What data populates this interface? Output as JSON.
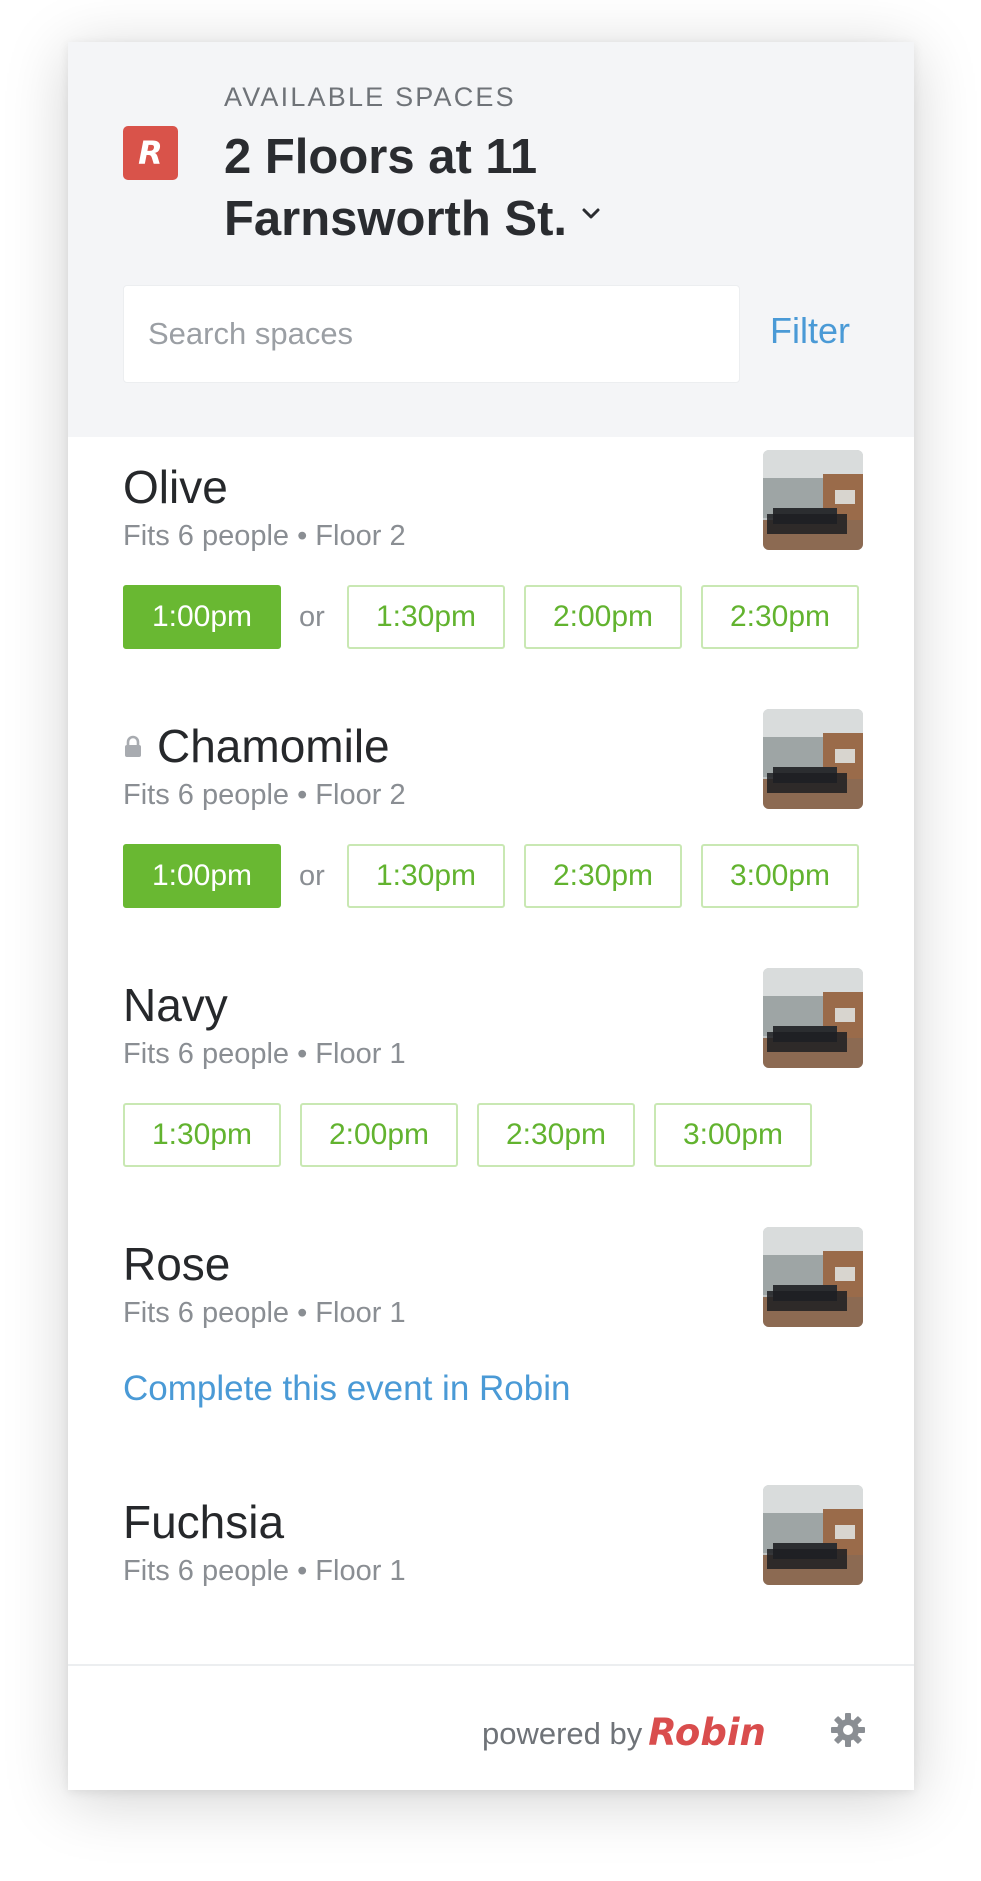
{
  "header": {
    "eyebrow": "AVAILABLE SPACES",
    "title": "2 Floors at 11 Farnsworth St.",
    "logo_letter": "R",
    "search_placeholder": "Search spaces",
    "filter_label": "Filter"
  },
  "rooms": [
    {
      "name": "Olive",
      "meta": "Fits 6 people • Floor 2",
      "locked": false,
      "primary_time": "1:00pm",
      "or_label": "or",
      "times": [
        "1:30pm",
        "2:00pm",
        "2:30pm"
      ]
    },
    {
      "name": "Chamomile",
      "meta": "Fits 6 people • Floor 2",
      "locked": true,
      "primary_time": "1:00pm",
      "or_label": "or",
      "times": [
        "1:30pm",
        "2:30pm",
        "3:00pm"
      ]
    },
    {
      "name": "Navy",
      "meta": "Fits 6 people • Floor 1",
      "locked": false,
      "times": [
        "1:30pm",
        "2:00pm",
        "2:30pm",
        "3:00pm"
      ]
    },
    {
      "name": "Rose",
      "meta": "Fits 6 people • Floor 1",
      "locked": false,
      "link": "Complete this event in Robin"
    },
    {
      "name": "Fuchsia",
      "meta": "Fits 6 people • Floor 1",
      "locked": false
    }
  ],
  "footer": {
    "powered_by": "powered by",
    "brand": "Robin"
  },
  "colors": {
    "accent_green": "#69b832",
    "link_blue": "#4a9ad6",
    "brand_red": "#d9534a"
  },
  "icons": {
    "logo": "robin-logo-icon",
    "chevron": "chevron-down-icon",
    "lock": "lock-icon",
    "settings": "gear-icon"
  }
}
